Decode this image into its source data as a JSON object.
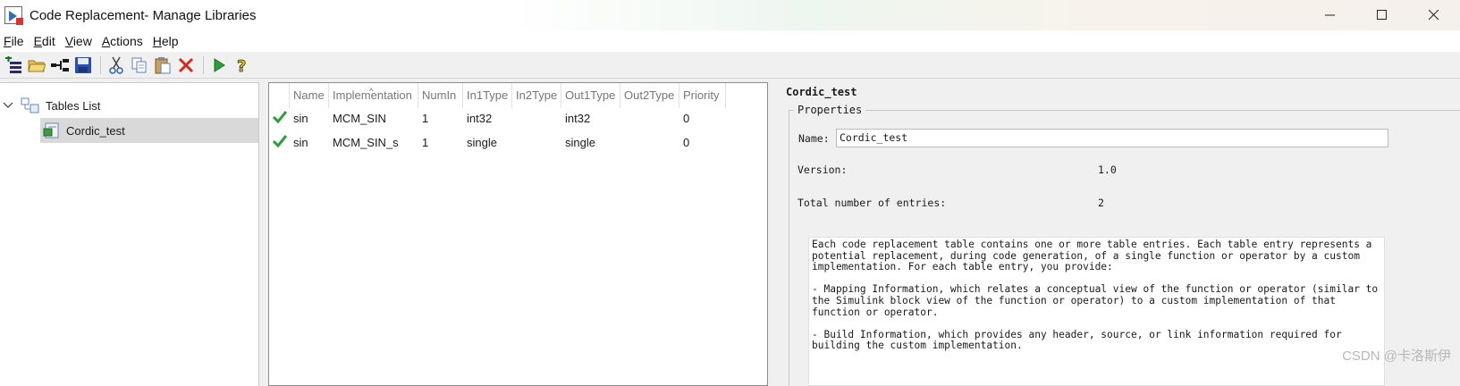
{
  "window": {
    "title": "Code Replacement- Manage Libraries",
    "controls": [
      "minimize",
      "maximize",
      "close"
    ]
  },
  "menu": [
    {
      "label": "File",
      "mnemonic": "F",
      "rest": "ile"
    },
    {
      "label": "Edit",
      "mnemonic": "E",
      "rest": "dit"
    },
    {
      "label": "View",
      "mnemonic": "V",
      "rest": "iew"
    },
    {
      "label": "Actions",
      "mnemonic": "A",
      "rest": "ctions"
    },
    {
      "label": "Help",
      "mnemonic": "H",
      "rest": "elp"
    }
  ],
  "toolbar": {
    "icons": [
      "new-table-icon",
      "open-folder-icon",
      "new-entry-icon",
      "save-icon",
      "cut-icon",
      "copy-icon",
      "paste-icon",
      "delete-icon",
      "validate-run-icon",
      "help-icon"
    ]
  },
  "tree": {
    "root_label": "Tables List",
    "child_label": "Cordic_test"
  },
  "table": {
    "columns": [
      "Name",
      "Implementation",
      "NumIn",
      "In1Type",
      "In2Type",
      "Out1Type",
      "Out2Type",
      "Priority"
    ],
    "rows": [
      {
        "name": "sin",
        "implementation": "MCM_SIN",
        "numin": "1",
        "in1type": "int32",
        "in2type": "",
        "out1type": "int32",
        "out2type": "",
        "priority": "0"
      },
      {
        "name": "sin",
        "implementation": "MCM_SIN_s",
        "numin": "1",
        "in1type": "single",
        "in2type": "",
        "out1type": "single",
        "out2type": "",
        "priority": "0"
      }
    ]
  },
  "properties": {
    "table_name": "Cordic_test",
    "group_label": "Properties",
    "name_label": "Name:",
    "name_value": "Cordic_test",
    "version_label": "Version:",
    "version_value": "1.0",
    "entries_label": "Total number of entries:",
    "entries_value": "2",
    "description": "Each code replacement table contains one or more table entries. Each table entry represents a\npotential replacement, during code generation, of a single function or operator by a custom\nimplementation. For each table entry, you provide:\n\n- Mapping Information, which relates a conceptual view of the function or operator (similar to\nthe Simulink block view of the function or operator) to a custom implementation of that\nfunction or operator.\n\n- Build Information, which provides any header, source, or link information required for\nbuilding the custom implementation."
  },
  "watermark": "CSDN @卡洛斯伊",
  "colors": {
    "selection": "#d9d9d9",
    "check_green": "#2e9e3a",
    "delete_red": "#d9271c"
  }
}
